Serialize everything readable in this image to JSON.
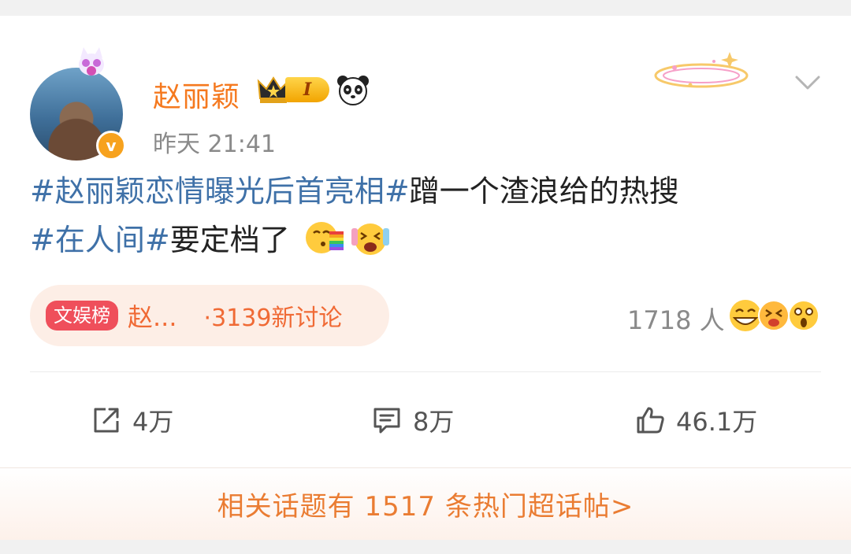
{
  "post": {
    "username": "赵丽颖",
    "vip_level": "I",
    "verified_mark": "v",
    "time": "昨天 21:41",
    "text": {
      "tag1": "#赵丽颖恋情曝光后首亮相#",
      "line1_rest": "蹭一个渣浪给的热搜",
      "tag2": "#在人间#",
      "line2_rest": "要定档了"
    }
  },
  "hot_topic": {
    "badge": "文娱榜",
    "topic": "赵...",
    "discussions": "·3139新讨论"
  },
  "reactions": {
    "people": "1718 人"
  },
  "actions": {
    "repost_count": "4万",
    "comment_count": "8万",
    "like_count": "46.1万"
  },
  "footer": {
    "text": "相关话题有 1517 条热门超话帖>"
  },
  "icons": [
    "crown-icon",
    "panda-icon",
    "chevron-down-icon",
    "repost-icon",
    "comment-icon",
    "like-icon",
    "rainbow-kiss-emoji",
    "excited-emoji",
    "grin-emoji",
    "laugh-emoji",
    "surprised-emoji"
  ],
  "colors": {
    "username": "#f5791f",
    "hashtag": "#3f71a8",
    "topic": "#f06a35",
    "footer_text": "#ea7c32",
    "badge": "#ef4f5b"
  }
}
